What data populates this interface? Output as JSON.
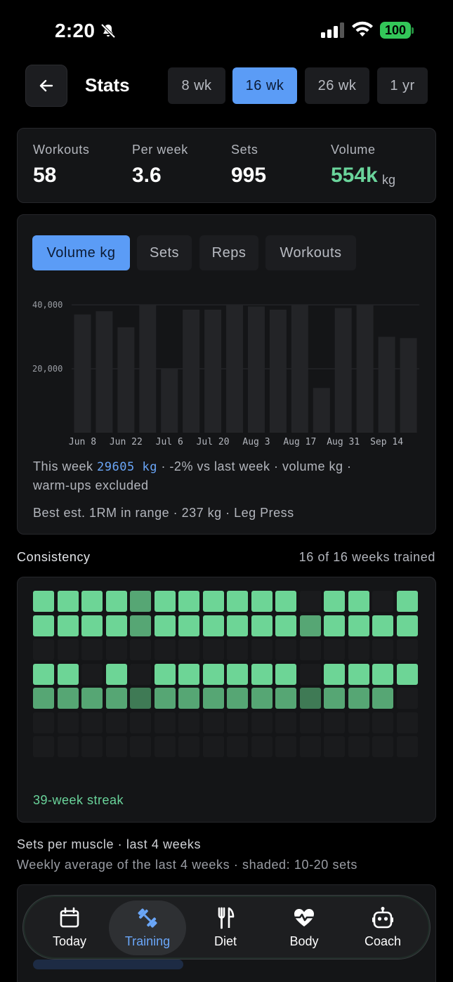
{
  "status_bar": {
    "time": "2:20",
    "battery": "100"
  },
  "header": {
    "title": "Stats",
    "range_tabs": [
      "8 wk",
      "16 wk",
      "26 wk",
      "1 yr"
    ],
    "active_range": "16 wk"
  },
  "summary": {
    "workouts_label": "Workouts",
    "workouts_value": "58",
    "per_week_label": "Per week",
    "per_week_value": "3.6",
    "sets_label": "Sets",
    "sets_value": "995",
    "volume_label": "Volume",
    "volume_value": "554k",
    "volume_unit": "kg"
  },
  "metric_tabs": [
    "Volume kg",
    "Sets",
    "Reps",
    "Workouts"
  ],
  "active_metric": "Volume kg",
  "chart_data": {
    "type": "bar",
    "title": "",
    "xlabel": "",
    "ylabel": "",
    "ylim": [
      0,
      40000
    ],
    "yticks": [
      "20,000",
      "40,000"
    ],
    "x_tick_labels": [
      "Jun 8",
      "Jun 22",
      "Jul 6",
      "Jul 20",
      "Aug 3",
      "Aug 17",
      "Aug 31",
      "Sep 14"
    ],
    "categories": [
      "Jun 8",
      "Jun 15",
      "Jun 22",
      "Jun 29",
      "Jul 6",
      "Jul 13",
      "Jul 20",
      "Jul 27",
      "Aug 3",
      "Aug 10",
      "Aug 17",
      "Aug 24",
      "Aug 31",
      "Sep 7",
      "Sep 14",
      "Sep 21"
    ],
    "values": [
      37000,
      38000,
      33000,
      40000,
      20000,
      38500,
      38500,
      40000,
      39500,
      38500,
      40000,
      14000,
      39000,
      40000,
      30000,
      29605
    ],
    "grid": true,
    "bar_color": "#232427"
  },
  "chart_notes": {
    "this_week_prefix": "This week",
    "this_week_value": "29605 kg",
    "this_week_suffix": " · -2% vs last week · volume kg ·",
    "line2": "warm-ups excluded",
    "best": "Best est. 1RM in range · 237 kg · Leg Press"
  },
  "consistency": {
    "title": "Consistency",
    "summary": "16 of 16 weeks trained",
    "streak": "39-week streak",
    "colors": {
      "0": "#1a1b1d",
      "1": "#3f7a55",
      "2": "#56a674",
      "3": "#6dd596"
    },
    "rows": [
      [
        3,
        3,
        3,
        3,
        2,
        3,
        3,
        3,
        3,
        3,
        3,
        0,
        3,
        3,
        0,
        3
      ],
      [
        3,
        3,
        3,
        3,
        2,
        3,
        3,
        3,
        3,
        3,
        3,
        2,
        3,
        3,
        3,
        3
      ],
      [
        0,
        0,
        0,
        0,
        0,
        0,
        0,
        0,
        0,
        0,
        0,
        0,
        0,
        0,
        0,
        0
      ],
      [
        3,
        3,
        0,
        3,
        0,
        3,
        3,
        3,
        3,
        3,
        3,
        0,
        3,
        3,
        3,
        3
      ],
      [
        2,
        2,
        2,
        2,
        1,
        2,
        2,
        2,
        2,
        2,
        2,
        1,
        2,
        2,
        2,
        0
      ],
      [
        0,
        0,
        0,
        0,
        0,
        0,
        0,
        0,
        0,
        0,
        0,
        0,
        0,
        0,
        0,
        0
      ],
      [
        0,
        0,
        0,
        0,
        0,
        0,
        0,
        0,
        0,
        0,
        0,
        0,
        0,
        0,
        0,
        0
      ]
    ]
  },
  "muscles": {
    "title": "Sets per muscle · last 4 weeks",
    "subtitle": "Weekly average of the last 4 weeks · shaded: 10-20 sets"
  },
  "nav": {
    "items": [
      "Today",
      "Training",
      "Diet",
      "Body",
      "Coach"
    ],
    "active": "Training"
  },
  "colors": {
    "accent": "#5b9cf6",
    "green": "#6ad49b",
    "card": "#141517"
  }
}
